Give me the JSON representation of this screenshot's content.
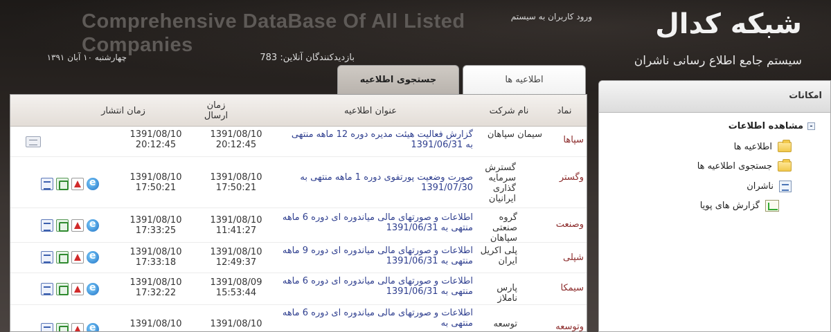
{
  "header": {
    "brand_title": "شبکه کدال",
    "brand_subtitle": "سیستم جامع اطلاع رسانی ناشران",
    "watermark": "Comprehensive DataBase Of All Listed Companies",
    "login_text": "ورود کاربران به سیستم",
    "visitors_label": "بازدیدکنندگان آنلاین: 783",
    "date_text": "چهارشنبه ۱۰ آبان ۱۳۹۱"
  },
  "sidebar": {
    "header": "امکانات",
    "root_label": "مشاهده اطلاعات",
    "root_toggle": "-",
    "items": [
      {
        "label": "اطلاعیه ها",
        "icon": "folder-icon"
      },
      {
        "label": "جستجوی اطلاعیه ها",
        "icon": "folder-icon"
      },
      {
        "label": "ناشران",
        "icon": "document-icon"
      },
      {
        "label": "گزارش های پویا",
        "icon": "chart-document-icon"
      }
    ]
  },
  "tabs": [
    {
      "label": "اطلاعیه ها",
      "active": true
    },
    {
      "label": "جستجوی اطلاعیه",
      "active": false
    }
  ],
  "table": {
    "columns": {
      "symbol": "نماد",
      "company": "نام شرکت",
      "title": "عنوان اطلاعیه",
      "sent_time": "زمان ارسال",
      "publish_time": "زمان انتشار"
    },
    "rows": [
      {
        "symbol": "سپاها",
        "company": "سیمان سپاهان",
        "title": "گزارش فعالیت هیئت مدیره دوره 12 ماهه منتهی به 1391/06/31",
        "sent_date": "1391/08/10",
        "sent_time": "20:12:45",
        "pub_date": "1391/08/10",
        "pub_time": "20:12:45",
        "icons": [
          "attachment-icon"
        ]
      },
      {
        "symbol": "وگستر",
        "company": "گسترش سرمایه گذاری ایرانیان",
        "title": "صورت وضعیت پورتفوی دوره 1 ماهه منتهی به 1391/07/30",
        "sent_date": "1391/08/10",
        "sent_time": "17:50:21",
        "pub_date": "1391/08/10",
        "pub_time": "17:50:21",
        "icons": [
          "ie-icon",
          "pdf-icon",
          "excel-icon",
          "word-icon"
        ]
      },
      {
        "symbol": "وصنعت",
        "company": "گروه صنعتی سپاهان",
        "title": "اطلاعات و صورتهای مالی میاندوره ای دوره 6 ماهه منتهی به 1391/06/31",
        "sent_date": "1391/08/10",
        "sent_time": "11:41:27",
        "pub_date": "1391/08/10",
        "pub_time": "17:33:25",
        "icons": [
          "ie-icon",
          "pdf-icon",
          "excel-icon",
          "word-icon"
        ]
      },
      {
        "symbol": "شپلی",
        "company": "پلی اکریل ایران",
        "title": "اطلاعات و صورتهای مالی میاندوره ای دوره 9 ماهه منتهی به 1391/06/31",
        "sent_date": "1391/08/10",
        "sent_time": "12:49:37",
        "pub_date": "1391/08/10",
        "pub_time": "17:33:18",
        "icons": [
          "ie-icon",
          "pdf-icon",
          "excel-icon",
          "word-icon"
        ]
      },
      {
        "symbol": "سیمکا",
        "company": "پارس ناملاز",
        "title": "اطلاعات و صورتهای مالی میاندوره ای دوره 6 ماهه منتهی به 1391/06/31",
        "sent_date": "1391/08/09",
        "sent_time": "15:53:44",
        "pub_date": "1391/08/10",
        "pub_time": "17:32:22",
        "icons": [
          "ie-icon",
          "pdf-icon",
          "excel-icon",
          "word-icon"
        ]
      },
      {
        "symbol": "وتوسعه",
        "company": "توسعه",
        "title": "اطلاعات و صورتهای مالی میاندوره ای دوره 6 ماهه منتهی به",
        "sent_date": "1391/08/10",
        "sent_time": "",
        "pub_date": "1391/08/10",
        "pub_time": "",
        "icons": [
          "ie-icon",
          "pdf-icon",
          "excel-icon",
          "word-icon"
        ]
      }
    ]
  },
  "colors": {
    "background_dark": "#1d1a18",
    "symbol_text": "#8b2a2a",
    "title_link": "#2f3f8f"
  }
}
